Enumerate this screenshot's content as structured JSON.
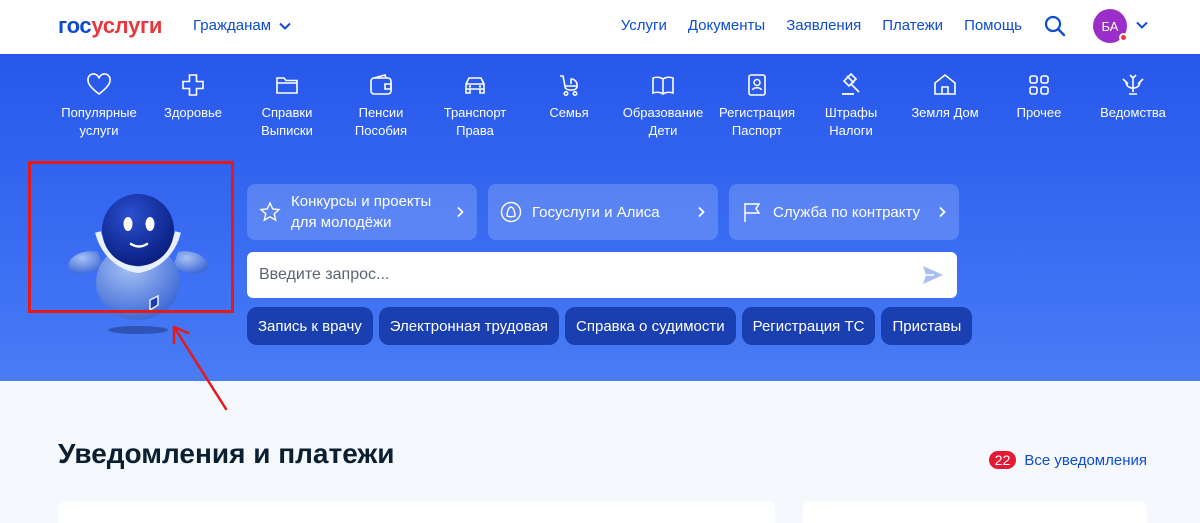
{
  "header": {
    "logo_part1": "гос",
    "logo_part2": "услуги",
    "audience_label": "Гражданам",
    "nav": [
      "Услуги",
      "Документы",
      "Заявления",
      "Платежи",
      "Помощь"
    ],
    "avatar_initials": "БА"
  },
  "categories": [
    {
      "label": "Популярные услуги",
      "icon": "heart-icon"
    },
    {
      "label": "Здоровье",
      "icon": "medical-cross-icon"
    },
    {
      "label": "Справки Выписки",
      "icon": "folder-icon"
    },
    {
      "label": "Пенсии Пособия",
      "icon": "wallet-icon"
    },
    {
      "label": "Транспорт Права",
      "icon": "car-icon"
    },
    {
      "label": "Семья",
      "icon": "stroller-icon"
    },
    {
      "label": "Образование Дети",
      "icon": "book-icon"
    },
    {
      "label": "Регистрация Паспорт",
      "icon": "passport-icon"
    },
    {
      "label": "Штрафы Налоги",
      "icon": "gavel-icon"
    },
    {
      "label": "Земля Дом",
      "icon": "house-icon"
    },
    {
      "label": "Прочее",
      "icon": "grid-icon"
    },
    {
      "label": "Ведомства",
      "icon": "emblem-icon"
    }
  ],
  "quick_links": [
    {
      "label": "Конкурсы и проекты для молодёжи",
      "icon": "star-icon"
    },
    {
      "label": "Госуслуги и Алиса",
      "icon": "alice-icon"
    },
    {
      "label": "Служба по контракту",
      "icon": "flag-icon"
    }
  ],
  "search": {
    "placeholder": "Введите запрос..."
  },
  "chips": [
    "Запись к врачу",
    "Электронная трудовая",
    "Справка о судимости",
    "Регистрация ТС",
    "Приставы"
  ],
  "notifications": {
    "title": "Уведомления и платежи",
    "count": "22",
    "all_link": "Все уведомления"
  },
  "colors": {
    "brand_blue": "#0d4cd3",
    "brand_red": "#e8373e",
    "hero_blue": "#2f62ef",
    "chip_blue": "#1a3fb0",
    "annotation_red": "#e31a1a"
  }
}
